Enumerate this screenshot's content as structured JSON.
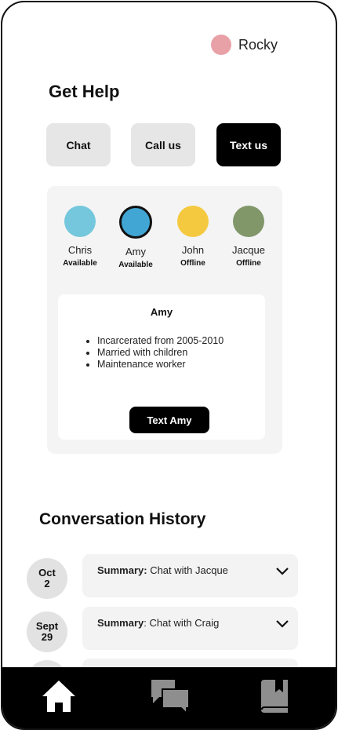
{
  "user": {
    "name": "Rocky",
    "avatar_color": "#e8a1a7"
  },
  "get_help": {
    "title": "Get Help",
    "modes": [
      {
        "label": "Chat",
        "active": false
      },
      {
        "label": "Call us",
        "active": false
      },
      {
        "label": "Text us",
        "active": true
      }
    ]
  },
  "agents": [
    {
      "name": "Chris",
      "status": "Available",
      "color": "#74c7dc"
    },
    {
      "name": "Amy",
      "status": "Available",
      "color": "#41a6d3",
      "selected": true
    },
    {
      "name": "John",
      "status": "Offline",
      "color": "#f4c93f"
    },
    {
      "name": "Jacque",
      "status": "Offline",
      "color": "#81976a"
    }
  ],
  "selected_agent": {
    "name": "Amy",
    "details": [
      "Incarcerated from 2005-2010",
      "Married with children",
      "Maintenance worker"
    ],
    "button_label": "Text Amy"
  },
  "history": {
    "title": "Conversation History",
    "items": [
      {
        "date_line1": "Oct",
        "date_line2": "2",
        "summary_label": "Summary:",
        "summary_text": " Chat with Jacque"
      },
      {
        "date_line1": "Sept",
        "date_line2": "29",
        "summary_label": "Summary",
        "summary_text": ": Chat with Craig"
      }
    ]
  },
  "nav": {
    "items": [
      "home-icon",
      "chat-icon",
      "book-icon"
    ]
  }
}
